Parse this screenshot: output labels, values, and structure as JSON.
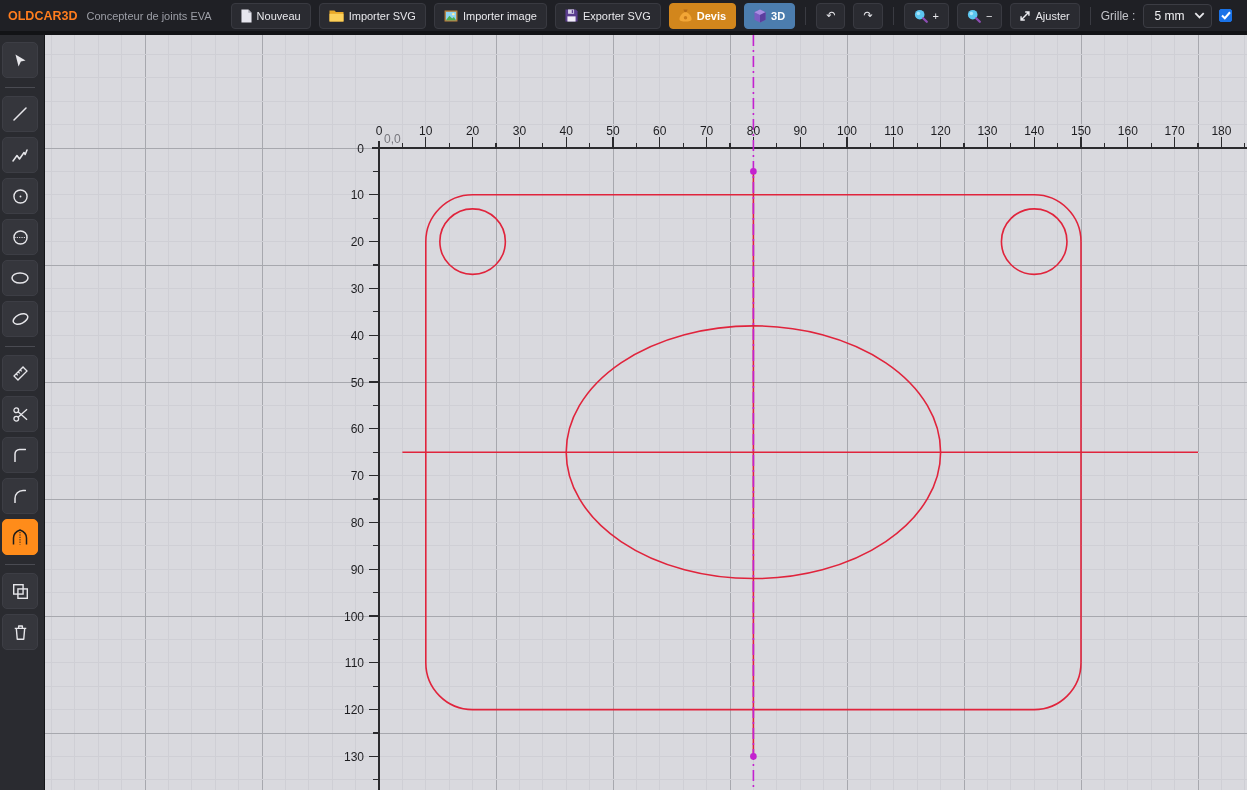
{
  "header": {
    "logo": "OLDCAR3D",
    "subtitle": "Concepteur de joints EVA"
  },
  "toolbar": {
    "groups": [
      {
        "buttons": [
          {
            "label": "Nouveau",
            "kind": "default"
          },
          {
            "label": "Importer SVG",
            "kind": "default"
          },
          {
            "label": "Importer image",
            "kind": "default"
          },
          {
            "label": "Exporter SVG",
            "kind": "default"
          },
          {
            "label": "Devis",
            "kind": "accent"
          },
          {
            "label": "3D",
            "kind": "primary"
          }
        ]
      },
      {
        "buttons": [
          {
            "label": "↶",
            "kind": "default"
          },
          {
            "label": "↷",
            "kind": "default"
          }
        ]
      },
      {
        "buttons": [
          {
            "label": "+",
            "kind": "default"
          },
          {
            "label": "−",
            "kind": "default"
          },
          {
            "label": "Ajuster",
            "kind": "default"
          }
        ]
      }
    ],
    "grid": {
      "label": "Grille :",
      "value": "5 mm"
    },
    "checkbox": {
      "checked": true
    }
  },
  "sidebar": {
    "groups": [
      {
        "tools": [
          {
            "selected": false
          }
        ]
      },
      {
        "tools": [
          {
            "selected": false
          },
          {
            "selected": false
          },
          {
            "selected": false
          },
          {
            "selected": false
          },
          {
            "selected": false
          },
          {
            "selected": false
          }
        ]
      },
      {
        "tools": [
          {
            "selected": false
          },
          {
            "selected": false
          },
          {
            "selected": false
          },
          {
            "selected": false
          },
          {
            "selected": true
          }
        ]
      },
      {
        "tools": [
          {
            "selected": false
          },
          {
            "selected": false
          }
        ]
      }
    ]
  },
  "canvas": {
    "origin_label": "0,0",
    "x_ruler": [
      "0",
      "10",
      "20",
      "30",
      "40",
      "50",
      "60",
      "70",
      "80",
      "90",
      "100",
      "110",
      "120",
      "130",
      "140",
      "150",
      "160",
      "170",
      "180"
    ],
    "y_ruler": [
      "0",
      "10",
      "20",
      "30",
      "40",
      "50",
      "60",
      "70",
      "80",
      "90",
      "100",
      "110",
      "120",
      "130"
    ]
  }
}
